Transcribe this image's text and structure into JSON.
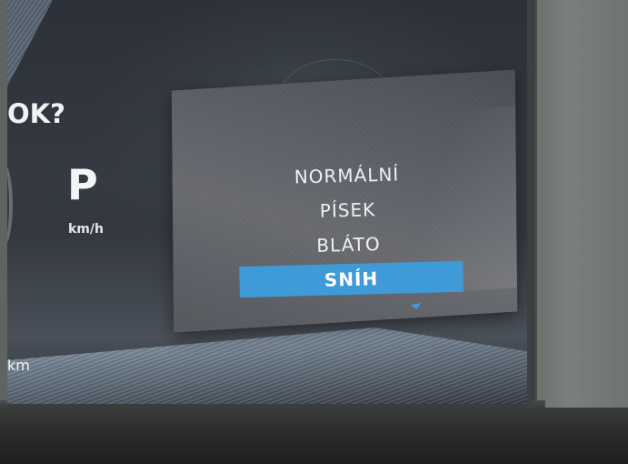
{
  "cluster": {
    "prompt": "OK?",
    "gear": "P",
    "speed_unit": "km/h",
    "distance_unit": "km"
  },
  "drive_mode_menu": {
    "items": [
      "NORMÁLNÍ",
      "PÍSEK",
      "BLÁTO",
      "SNÍH"
    ],
    "selected_index": 3
  },
  "colors": {
    "selection": "#3f9ad8",
    "menu_text": "#eef0f2",
    "screen_bg": "#2f333a"
  },
  "icons": {
    "menu_pointer": "triangle-pointer-icon"
  }
}
